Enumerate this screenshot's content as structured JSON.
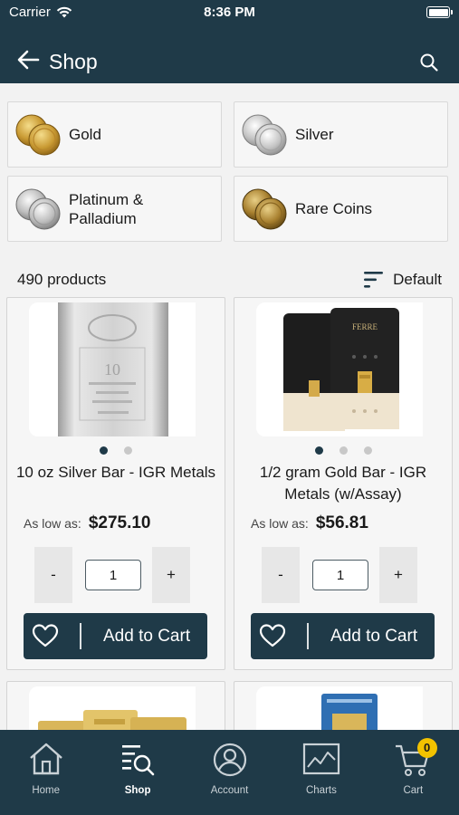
{
  "status_bar": {
    "carrier": "Carrier",
    "time": "8:36 PM"
  },
  "nav": {
    "title": "Shop",
    "back_icon": "arrow-left-icon",
    "search_icon": "search-icon"
  },
  "categories": [
    {
      "label": "Gold"
    },
    {
      "label": "Silver"
    },
    {
      "label": "Platinum &\nPalladium"
    },
    {
      "label": "Rare Coins"
    }
  ],
  "results": {
    "count": "490 products",
    "sort": "Default"
  },
  "products": [
    {
      "name": "10 oz Silver Bar - IGR Metals",
      "price_label": "As low as:",
      "price": "$275.10",
      "quantity": "1",
      "minus": "-",
      "plus": "+",
      "add_to_cart": "Add to Cart",
      "image_count": 2,
      "image_index": 0
    },
    {
      "name": "1/2 gram Gold Bar - IGR Metals (w/Assay)",
      "price_label": "As low as:",
      "price": "$56.81",
      "quantity": "1",
      "minus": "-",
      "plus": "+",
      "add_to_cart": "Add to Cart",
      "image_count": 3,
      "image_index": 0
    }
  ],
  "tabs": [
    {
      "label": "Home",
      "icon": "home-icon"
    },
    {
      "label": "Shop",
      "icon": "shop-icon",
      "active": true
    },
    {
      "label": "Account",
      "icon": "account-icon"
    },
    {
      "label": "Charts",
      "icon": "charts-icon"
    },
    {
      "label": "Cart",
      "icon": "cart-icon",
      "badge": "0"
    }
  ],
  "colors": {
    "primary": "#1f3a48",
    "badge": "#f2c200",
    "background": "#f2f2f2"
  }
}
